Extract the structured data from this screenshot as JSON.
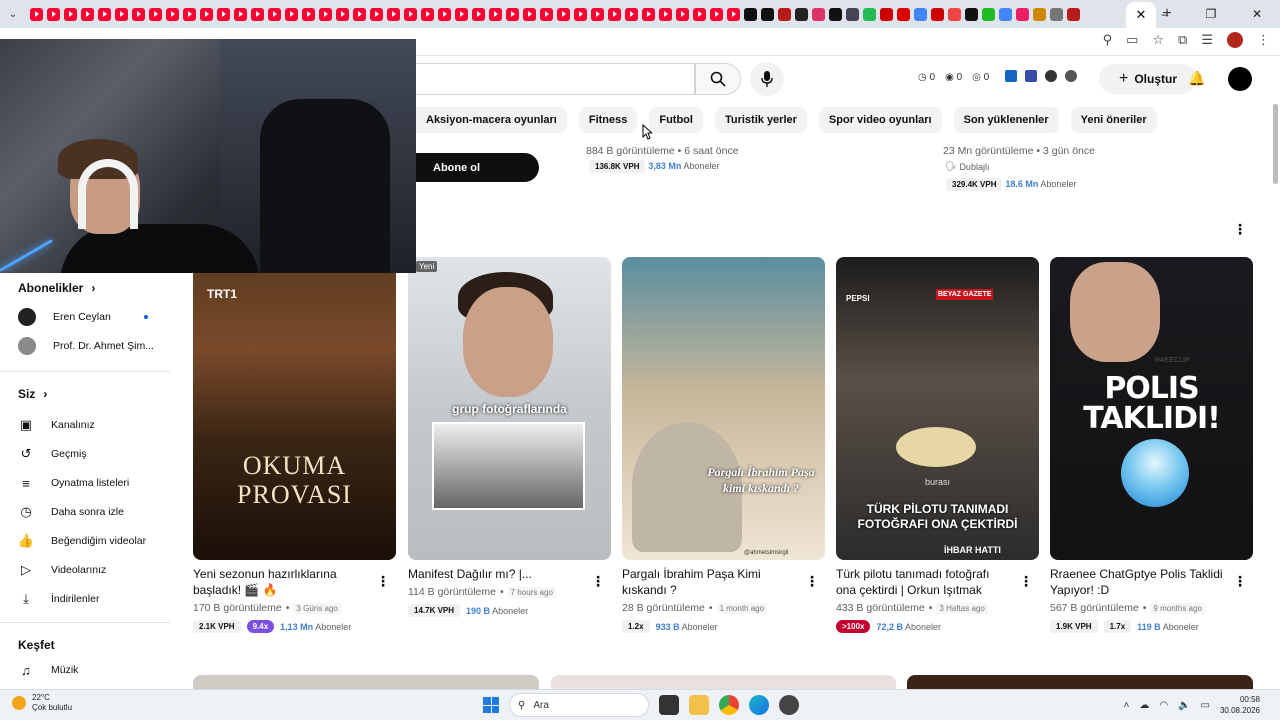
{
  "browser": {
    "tab_close": "✕",
    "new_tab": "+",
    "window_controls": [
      "–",
      "❐",
      "✕"
    ]
  },
  "header": {
    "counters": [
      {
        "icon": "clock-icon",
        "value": "0"
      },
      {
        "icon": "eye-icon",
        "value": "0"
      },
      {
        "icon": "eye-slash-icon",
        "value": "0"
      }
    ],
    "create_label": "Oluştur"
  },
  "chips": [
    "Aksiyon-macera oyunları",
    "Fitness",
    "Futbol",
    "Turistik yerler",
    "Spor video oyunları",
    "Son yüklenenler",
    "Yeni öneriler"
  ],
  "top_row": {
    "subscribe_label": "Abone ol",
    "left": {
      "views": "884 B görüntüleme",
      "ago": "6 saat önce",
      "vph": "136.8K VPH",
      "subs_value": "3,83 Mn",
      "subs_label": "Aboneler"
    },
    "right": {
      "views": "23 Mn görüntüleme",
      "ago": "3 gün önce",
      "dubbed": "Dublajlı",
      "vph": "329.4K VPH",
      "subs_value": "18.6 Mn",
      "subs_label": "Aboneler"
    }
  },
  "sidebar": {
    "subscriptions_title": "Abonelikler",
    "subscriptions": [
      {
        "name": "Eren Ceylan"
      },
      {
        "name": "Prof. Dr. Ahmet Şim..."
      }
    ],
    "you_title": "Siz",
    "you_items": [
      {
        "label": "Kanalınız",
        "icon": "channel-icon",
        "glyph": "▣"
      },
      {
        "label": "Geçmiş",
        "icon": "history-icon",
        "glyph": "↺"
      },
      {
        "label": "Oynatma listeleri",
        "icon": "playlists-icon",
        "glyph": "≡"
      },
      {
        "label": "Daha sonra izle",
        "icon": "watch-later-icon",
        "glyph": "◷"
      },
      {
        "label": "Beğendiğim videolar",
        "icon": "like-icon",
        "glyph": "👍"
      },
      {
        "label": "Videolarınız",
        "icon": "your-videos-icon",
        "glyph": "▷"
      },
      {
        "label": "İndirilenler",
        "icon": "download-icon",
        "glyph": "⤓"
      }
    ],
    "explore_title": "Keşfet",
    "explore_items": [
      {
        "label": "Müzik",
        "icon": "music-icon",
        "glyph": "♫"
      }
    ]
  },
  "videos": [
    {
      "title": "Yeni sezonun hazırlıklarına başladık! 🎬 🔥",
      "views": "170 B görüntüleme",
      "ago": "3 Güns ago",
      "vph": "2.1K VPH",
      "multiplier": "9.4x",
      "mult_style": "purple",
      "subs_value": "1,13 Mn",
      "subs_label": "Aboneler",
      "thumb_text": "OKUMA PROVASI",
      "thumb_channel": "TRT1"
    },
    {
      "title": "Manifest Dağılır mı? |...",
      "views": "114 B görüntüleme",
      "ago": "7 hours ago",
      "vph": "14.7K VPH",
      "multiplier": "",
      "mult_style": "",
      "subs_value": "190 B",
      "subs_label": "Aboneler",
      "thumb_text": "grup fotoğraflarında",
      "badge": "Yeni"
    },
    {
      "title": "Pargalı İbrahim Paşa Kimi kıskandı ?",
      "views": "28 B görüntüleme",
      "ago": "1 month ago",
      "vph": "",
      "multiplier": "1.2x",
      "mult_style": "gray",
      "subs_value": "933 B",
      "subs_label": "Aboneler",
      "thumb_text": "Pargalı İbrahim Paşa kimi kıskandı ?",
      "thumb_credit": "@ahmetsimsirgil"
    },
    {
      "title": "Türk pilotu tanımadı fotoğrafı ona çektirdi | Orkun Işıtmak",
      "views": "433 B görüntüleme",
      "ago": "3 Haftas ago",
      "vph": "",
      "multiplier": ">100x",
      "mult_style": "red",
      "subs_value": "72,2 B",
      "subs_label": "Aboneler",
      "thumb_text": "TÜRK PİLOTU TANIMADI FOTOĞRAFI ONA ÇEKTİRDİ",
      "thumb_caption": "burası",
      "thumb_brand": "BEYAZ GAZETE",
      "thumb_pepsi": "PEPSI",
      "thumb_bottom": "İHBAR HATTI"
    },
    {
      "title": "Rraenee ChatGptye Polis Taklidi Yapıyor! :D",
      "views": "567 B görüntüleme",
      "ago": "9 months ago",
      "vph": "1.9K VPH",
      "multiplier": "1.7x",
      "mult_style": "gray",
      "subs_value": "119 B",
      "subs_label": "Aboneler",
      "thumb_text": "POLIS TAKLIDI!",
      "thumb_watermark": "RAEECLIP"
    }
  ],
  "taskbar": {
    "temperature": "22°C",
    "weather": "Çok bulutlu",
    "search_placeholder": "Ara",
    "time": "00:58",
    "date": "30.08.2026"
  },
  "colors": {
    "youtube_red": "#ff0033",
    "subscriber_blue": "#3f7fd6",
    "purple_pill": "#7b4fe0",
    "red_pill": "#c3002f"
  }
}
